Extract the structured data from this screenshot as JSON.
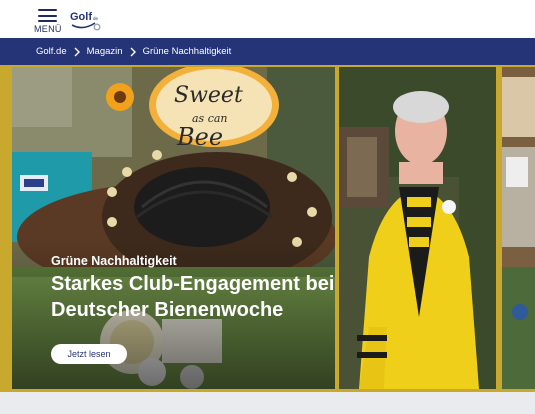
{
  "header": {
    "menu_label": "MENÜ",
    "logo_text": "Golf",
    "logo_suffix": "de"
  },
  "breadcrumb": {
    "items": [
      {
        "label": "Golf.de"
      },
      {
        "label": "Magazin"
      },
      {
        "label": "Grüne Nachhaltigkeit"
      }
    ]
  },
  "hero": {
    "category": "Grüne Nachhaltigkeit",
    "headline": "Starkes Club-Engagement bei Deutscher Bienenwoche",
    "button_label": "Jetzt lesen",
    "sign_line1": "Sweet",
    "sign_line2": "as can",
    "sign_line3": "Bee"
  },
  "colors": {
    "navy": "#253377",
    "gold": "#c8a92e",
    "white": "#ffffff"
  }
}
